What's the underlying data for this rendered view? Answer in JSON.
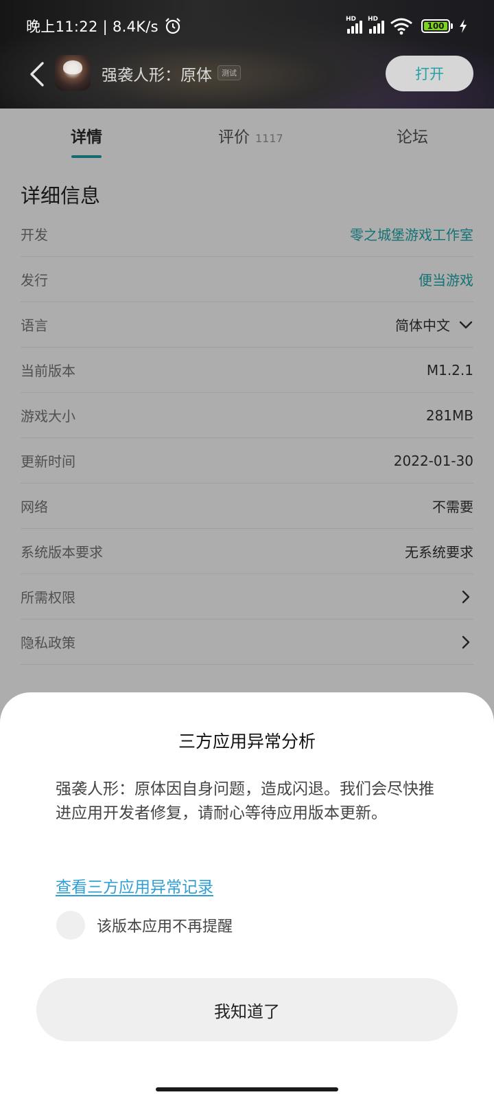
{
  "status_bar": {
    "time": "晚上11:22 | 8.4K/s",
    "hd_label": "HD",
    "battery": "100"
  },
  "app_bar": {
    "app_name": "强袭人形：原体",
    "badge": "测试",
    "open_label": "打开"
  },
  "tabs": [
    {
      "label": "详情"
    },
    {
      "label": "评价",
      "count": "1117"
    },
    {
      "label": "论坛"
    }
  ],
  "details": {
    "title": "详细信息",
    "rows": [
      {
        "label": "开发",
        "value": "零之城堡游戏工作室"
      },
      {
        "label": "发行",
        "value": "便当游戏"
      },
      {
        "label": "语言",
        "value": "简体中文"
      },
      {
        "label": "当前版本",
        "value": "M1.2.1"
      },
      {
        "label": "游戏大小",
        "value": "281MB"
      },
      {
        "label": "更新时间",
        "value": "2022-01-30"
      },
      {
        "label": "网络",
        "value": "不需要"
      },
      {
        "label": "系统版本要求",
        "value": "无系统要求"
      },
      {
        "label": "所需权限",
        "value": ""
      },
      {
        "label": "隐私政策",
        "value": ""
      }
    ]
  },
  "dialog": {
    "title": "三方应用异常分析",
    "message": "强袭人形：原体因自身问题，造成闪退。我们会尽快推进应用开发者修复，请耐心等待应用版本更新。",
    "link": "查看三方应用异常记录",
    "checkbox_label": "该版本应用不再提醒",
    "confirm_label": "我知道了"
  },
  "colors": {
    "accent": "#1fa8ad",
    "link": "#2f9ed4",
    "battery": "#7ed321"
  }
}
